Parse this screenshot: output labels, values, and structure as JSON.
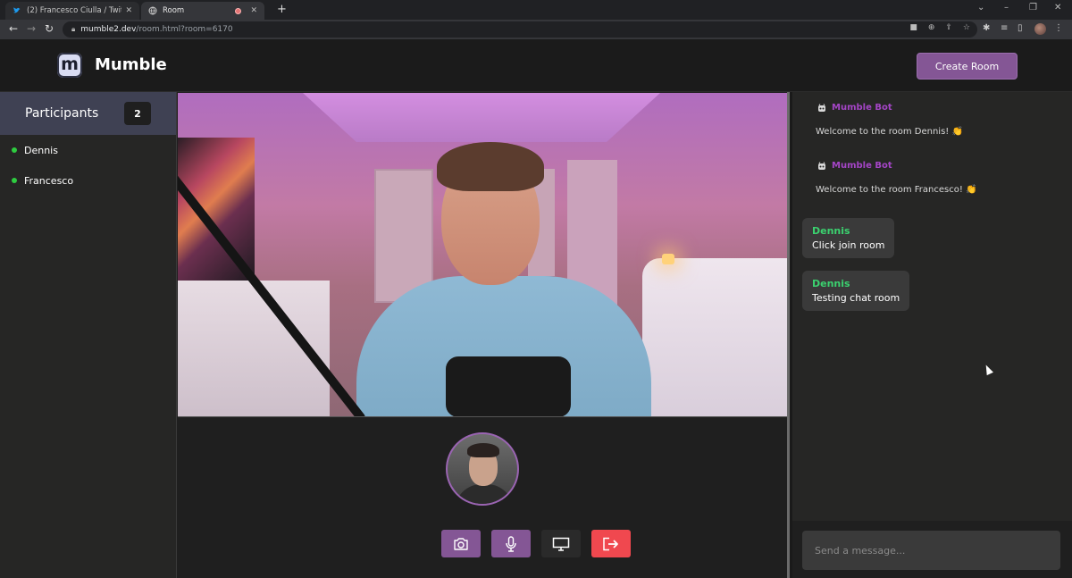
{
  "browser": {
    "tabs": [
      {
        "title": "(2) Francesco Ciulla / Twitter",
        "icon": "twitter-bird-icon",
        "active": false
      },
      {
        "title": "Room",
        "icon": "globe-icon",
        "active": true
      }
    ],
    "url_host": "mumble2.dev",
    "url_path": "/room.html?room=6170"
  },
  "header": {
    "logo_letter": "m",
    "app_name": "Mumble",
    "create_room_label": "Create Room"
  },
  "participants": {
    "title": "Participants",
    "count": "2",
    "items": [
      {
        "name": "Dennis"
      },
      {
        "name": "Francesco"
      }
    ]
  },
  "chat": {
    "messages": [
      {
        "author": "Mumble Bot",
        "text": "Welcome to the room Dennis! 👏"
      },
      {
        "author": "Mumble Bot",
        "text": "Welcome to the room Francesco! 👏"
      },
      {
        "author": "Dennis",
        "text": "Click join room"
      },
      {
        "author": "Dennis",
        "text": "Testing chat room"
      }
    ],
    "input_placeholder": "Send a message..."
  },
  "controls": [
    {
      "name": "camera-icon",
      "color": "#845695"
    },
    {
      "name": "microphone-icon",
      "color": "#845695"
    },
    {
      "name": "monitor-icon",
      "color": "#2a2a2a"
    },
    {
      "name": "leave-icon",
      "color": "#f0484f"
    }
  ],
  "colors": {
    "accent_purple": "#845695",
    "bot_name": "#a445c6",
    "online_green": "#2ecc40",
    "user_name_green": "#3bd16f",
    "leave_red": "#f0484f"
  }
}
